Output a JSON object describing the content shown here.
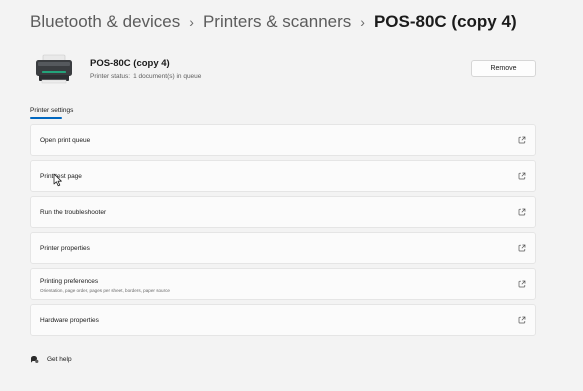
{
  "breadcrumb": {
    "item1": "Bluetooth & devices",
    "item2": "Printers & scanners",
    "current": "POS-80C (copy 4)"
  },
  "device": {
    "name": "POS-80C (copy 4)",
    "status_label": "Printer status:",
    "status_value": "1 document(s) in queue",
    "remove_label": "Remove"
  },
  "tabs": {
    "printer_settings": "Printer settings"
  },
  "settings": {
    "open_print_queue": "Open print queue",
    "print_test_page": "Print test page",
    "run_troubleshooter": "Run the troubleshooter",
    "printer_properties": "Printer properties",
    "printing_preferences": "Printing preferences",
    "printing_preferences_desc": "Orientation, page order, pages per sheet, borders, paper source",
    "hardware_properties": "Hardware properties"
  },
  "help": {
    "get_help": "Get help"
  },
  "icons": {
    "printer": "printer-icon",
    "external_link": "external-link-icon",
    "help": "help-icon",
    "cursor": "mouse-cursor-icon"
  },
  "colors": {
    "accent": "#0067c0",
    "background": "#f3f3f3",
    "card": "#fbfbfb"
  }
}
